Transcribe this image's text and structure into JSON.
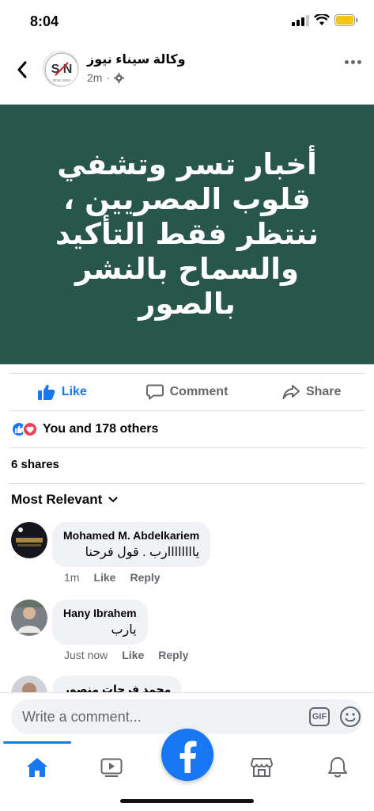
{
  "status_bar": {
    "time": "8:04"
  },
  "post": {
    "page_name": "وكالة سيناء نيوز",
    "avatar_text": "S N",
    "avatar_subtext": "sinai.news",
    "time": "2m",
    "separator": "·",
    "image_text": "أخبار تسر وتشفي قلوب المصريين ، ننتظر فقط التأكيد والسماح بالنشر بالصور",
    "background_color": "#29564a"
  },
  "actions": {
    "like": "Like",
    "comment": "Comment",
    "share": "Share"
  },
  "reactions": {
    "summary": "You and 178 others"
  },
  "shares": "6 shares",
  "sort": {
    "label": "Most Relevant"
  },
  "comments": [
    {
      "name": "Mohamed M. Abdelkariem",
      "text": "ياااااااارب . قول فرحنا",
      "time": "1m",
      "like": "Like",
      "reply": "Reply"
    },
    {
      "name": "Hany Ibrahem",
      "text": "يارب",
      "time": "Just now",
      "like": "Like",
      "reply": "Reply"
    },
    {
      "name": "محمد فرحات منصور"
    }
  ],
  "composer": {
    "placeholder": "Write a comment...",
    "gif": "GIF"
  },
  "accent": "#1877f2"
}
